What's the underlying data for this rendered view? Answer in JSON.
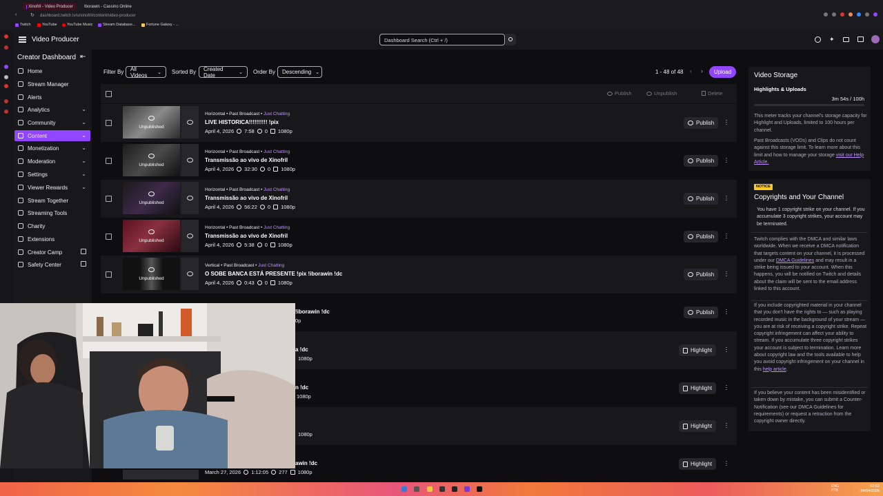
{
  "browser": {
    "tabs": [
      {
        "label": "Xinofril - Video Producer",
        "active": true
      },
      {
        "label": "Iborawin - Cassino Online",
        "active": false
      }
    ],
    "url": "dashboard.twitch.tv/u/xinofril/content/video-producer",
    "bookmarks": [
      "Twitch",
      "YouTube",
      "YouTube Music",
      "Stream Database...",
      "Fortune Galaxy - ..."
    ]
  },
  "topnav": {
    "title": "Video Producer",
    "search_placeholder": "Dashboard Search (Ctrl + /)"
  },
  "sidebar": {
    "header": "Creator Dashboard",
    "items": [
      {
        "label": "Home"
      },
      {
        "label": "Stream Manager"
      },
      {
        "label": "Alerts"
      },
      {
        "label": "Analytics"
      },
      {
        "label": "Community"
      },
      {
        "label": "Content"
      },
      {
        "label": "Monetization"
      },
      {
        "label": "Moderation"
      },
      {
        "label": "Settings"
      },
      {
        "label": "Viewer Rewards"
      },
      {
        "label": "Stream Together"
      },
      {
        "label": "Streaming Tools"
      },
      {
        "label": "Charity"
      },
      {
        "label": "Extensions"
      },
      {
        "label": "Creator Camp"
      },
      {
        "label": "Safety Center"
      }
    ]
  },
  "filters": {
    "filter_label": "Filter By",
    "filter_value": "All Videos",
    "sort_label": "Sorted By",
    "sort_value": "Created Date",
    "order_label": "Order By",
    "order_value": "Descending",
    "pagination": "1 - 48 of 48",
    "upload": "Upload"
  },
  "bulk": {
    "publish": "Publish",
    "unpublish": "Unpublish",
    "delete": "Delete"
  },
  "videos": [
    {
      "meta": "Horizontal • Past Broadcast •",
      "category": "Just Chatting",
      "title": "LIVE HISTORICA!!!!!!!!!! !pix",
      "date": "April 4, 2026",
      "duration": "7:58",
      "views": "0",
      "quality": "1080p",
      "thumb_label": "Unpublished",
      "action": "Publish"
    },
    {
      "meta": "Horizontal • Past Broadcast •",
      "category": "Just Chatting",
      "title": "Transmissão ao vivo de Xinofril",
      "date": "April 4, 2026",
      "duration": "32:30",
      "views": "0",
      "quality": "1080p",
      "thumb_label": "Unpublished",
      "action": "Publish"
    },
    {
      "meta": "Horizontal • Past Broadcast •",
      "category": "Just Chatting",
      "title": "Transmissão ao vivo de Xinofril",
      "date": "April 4, 2026",
      "duration": "56:22",
      "views": "0",
      "quality": "1080p",
      "thumb_label": "Unpublished",
      "action": "Publish"
    },
    {
      "meta": "Horizontal • Past Broadcast •",
      "category": "Just Chatting",
      "title": "Transmissão ao vivo de Xinofril",
      "date": "April 4, 2026",
      "duration": "5:38",
      "views": "0",
      "quality": "1080p",
      "thumb_label": "Unpublished",
      "action": "Publish"
    },
    {
      "meta": "Vertical • Past Broadcast •",
      "category": "Just Chatting",
      "title": "O SOBE BANCA ESTÁ PRESENTE !pix !iborawin !dc",
      "date": "April 4, 2026",
      "duration": "0:43",
      "views": "0",
      "quality": "1080p",
      "thumb_label": "Unpublished",
      "action": "Publish"
    }
  ],
  "partial_rows": [
    {
      "title_tail": "!iborawin !dc",
      "info_tail": "0p",
      "action": "Publish"
    },
    {
      "title_tail": "a !dc",
      "info_tail": "1080p",
      "action": "Highlight"
    },
    {
      "title_tail": "n !dc",
      "info_tail": "1080p",
      "action": "Highlight"
    },
    {
      "title_tail": "",
      "info_tail": "1080p",
      "action": "Highlight"
    },
    {
      "title_tail": "awin !dc",
      "date": "March 27, 2026",
      "duration": "1:12:05",
      "views": "277",
      "quality": "1080p",
      "action": "Highlight"
    }
  ],
  "storage": {
    "title": "Video Storage",
    "subtitle": "Highlights & Uploads",
    "usage": "3m 54s / 100h",
    "p1": "This meter tracks your channel's storage capacity for Highlight and Uploads, limited to 100 hours per channel.",
    "p2": "Past Broadcasts (VODs) and Clips do not count against this storage limit. To learn more about this limit and how to manage your storage",
    "p2_link": "visit our Help Article."
  },
  "copyright": {
    "badge": "NOTICE",
    "title": "Copyrights and Your Channel",
    "strike": "You have 1 copyright strike on your channel. If you accumulate 3 copyright strikes, your account may be terminated.",
    "p1a": "Twitch complies with the DMCA and similar laws worldwide. When we receive a DMCA notification that targets content on your channel, it is processed under our",
    "p1_link": "DMCA Guidelines",
    "p1b": "and may result in a strike being issued to your account. When this happens, you will be notified on Twitch and details about the claim will be sent to the email address linked to this account.",
    "p2a": "If you include copyrighted material in your channel that you don't have the rights to — such as playing recorded music in the background of your stream — you are at risk of receiving a copyright strike. Repeat copyright infringement can affect your ability to stream. If you accumulate three copyright strikes your account is subject to termination. Learn more about copyright law and the tools available to help you avoid copyright infringement on your channel in this",
    "p2_link": "help article",
    "p3": "If you believe your content has been misidentified or taken down by mistake, you can submit a Counter-Notification (see our DMCA Guidelines for requirements) or request a retraction from the copyright owner directly."
  },
  "taskbar": {
    "lang": "ENG PTB",
    "time": "02:52",
    "date": "04/04/2026"
  },
  "colors": {
    "accent": "#9147ff",
    "link": "#bf94ff",
    "notice": "#ffca28"
  }
}
